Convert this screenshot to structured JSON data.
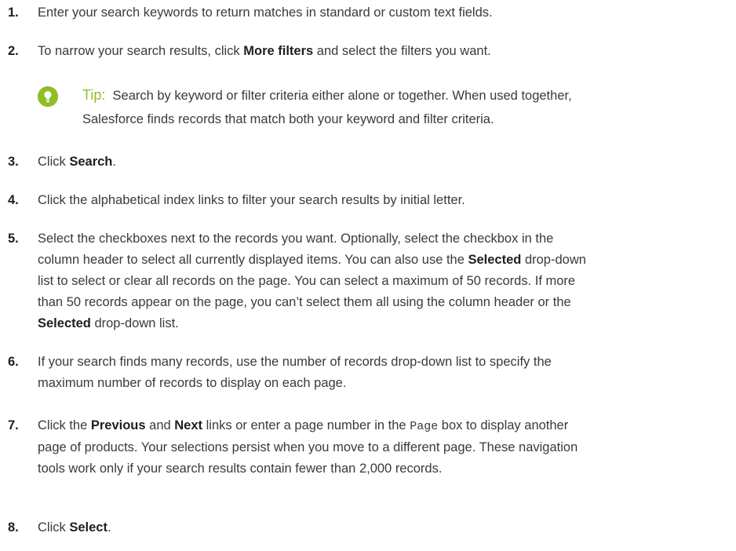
{
  "tip": {
    "label": "Tip:",
    "line1": "Search by keyword or filter criteria either alone or together. When used together,",
    "line2": "Salesforce finds records that match both your keyword and filter criteria."
  },
  "steps": [
    {
      "number": "1.",
      "text": "Enter your search keywords to return matches in standard or custom text fields."
    },
    {
      "number": "2.",
      "pre": "To narrow your search results, click ",
      "bold": "More filters",
      "post": " and select the filters you want."
    },
    {
      "number": "3.",
      "pre": "Click ",
      "bold": "Search",
      "post": "."
    },
    {
      "number": "4.",
      "text": "Click the alphabetical index links to filter your search results by initial letter."
    },
    {
      "number": "5.",
      "line1": "Select the checkboxes next to the records you want. Optionally, select the checkbox in the",
      "line2_pre": "column header to select all currently displayed items. You can also use the ",
      "line2_bold": "Selected",
      "line2_post": " drop-down",
      "line3": "list to select or clear all records on the page. You can select a maximum of 50 records. If more",
      "line4": "than 50 records appear on the page, you can’t select them all using the column header or the",
      "line5_bold": "Selected",
      "line5_post": " drop-down list."
    },
    {
      "number": "6.",
      "line1": "If your search finds many records, use the number of records drop-down list to specify the",
      "line2": "maximum number of records to display on each page."
    },
    {
      "number": "7.",
      "line1_pre": "Click the ",
      "line1_bold1": "Previous",
      "line1_mid": " and ",
      "line1_bold2": "Next",
      "line1_mid2": " links or enter a page number in the ",
      "line1_code": "Page",
      "line1_post": " box to display another",
      "line2": "page of products. Your selections persist when you move to a different page. These navigation",
      "line3": "tools work only if your search results contain fewer than 2,000 records."
    },
    {
      "number": "8.",
      "pre": "Click ",
      "bold": "Select",
      "post": "."
    }
  ]
}
